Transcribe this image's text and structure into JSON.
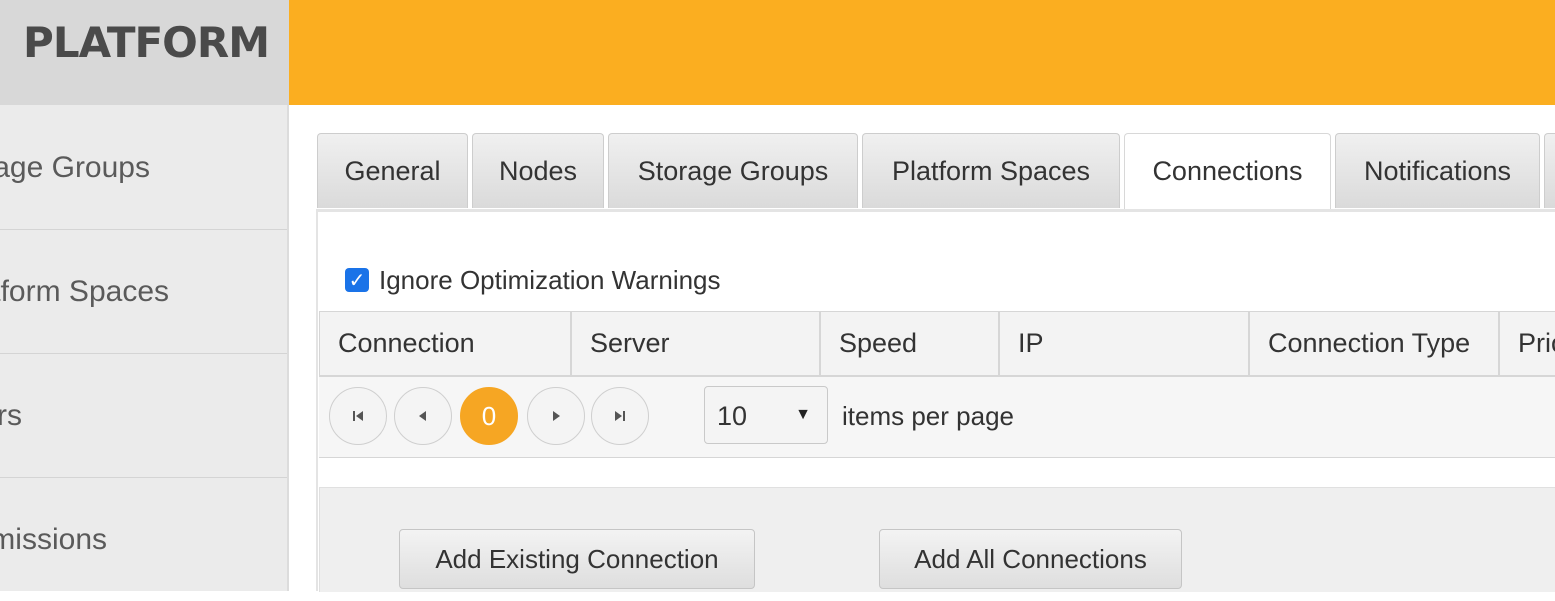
{
  "app": {
    "logo_text": "PLATFORM",
    "header_color": "#fbae20",
    "accent_color": "#f6a623"
  },
  "sidebar": {
    "items": [
      {
        "label": "Storage Groups"
      },
      {
        "label": "Platform Spaces"
      },
      {
        "label": "Users"
      },
      {
        "label": "Permissions"
      }
    ]
  },
  "tabs": [
    {
      "label": "General"
    },
    {
      "label": "Nodes"
    },
    {
      "label": "Storage Groups"
    },
    {
      "label": "Platform Spaces"
    },
    {
      "label": "Connections",
      "active": true
    },
    {
      "label": "Notifications"
    }
  ],
  "options": {
    "ignore_warnings_label": "Ignore Optimization Warnings",
    "ignore_warnings_checked": true
  },
  "grid": {
    "columns": [
      "Connection",
      "Server",
      "Speed",
      "IP",
      "Connection Type",
      "Priority"
    ]
  },
  "pager": {
    "current_page": "0",
    "page_size": "10",
    "items_per_page_label": "items per page",
    "icons": [
      "first-page-icon",
      "previous-page-icon",
      "next-page-icon",
      "last-page-icon"
    ]
  },
  "actions": {
    "add_existing_label": "Add Existing Connection",
    "add_all_label": "Add All Connections"
  }
}
